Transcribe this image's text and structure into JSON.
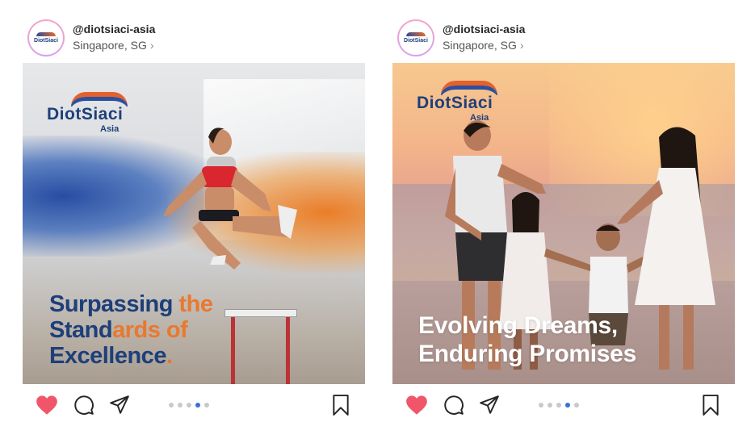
{
  "posts": [
    {
      "username": "@diotsiaci-asia",
      "location": "Singapore, SG",
      "brand": {
        "name": "DiotSiaci",
        "sub": "Asia"
      },
      "headline": {
        "line1a": "Surpassing",
        "line1b": " the",
        "line2a": "Stand",
        "line2b": "ards of",
        "line3a": "Excellence",
        "line3b": "."
      },
      "carousel": {
        "total": 5,
        "active_index": 3
      },
      "liked": true
    },
    {
      "username": "@diotsiaci-asia",
      "location": "Singapore, SG",
      "brand": {
        "name": "DiotSiaci",
        "sub": "Asia"
      },
      "headline": {
        "line1": "Evolving Dreams,",
        "line2": "Enduring Promises"
      },
      "carousel": {
        "total": 5,
        "active_index": 3
      },
      "liked": true
    }
  ],
  "icons": {
    "heart": "heart-icon",
    "comment": "comment-icon",
    "share": "send-icon",
    "bookmark": "bookmark-icon",
    "chevron": "chevron-right-icon"
  },
  "colors": {
    "brand_navy": "#1d3f7a",
    "brand_orange": "#e8792f",
    "like_red": "#f0556a",
    "dot_active": "#3c6fd6",
    "dot_inactive": "#c9c9c9"
  }
}
